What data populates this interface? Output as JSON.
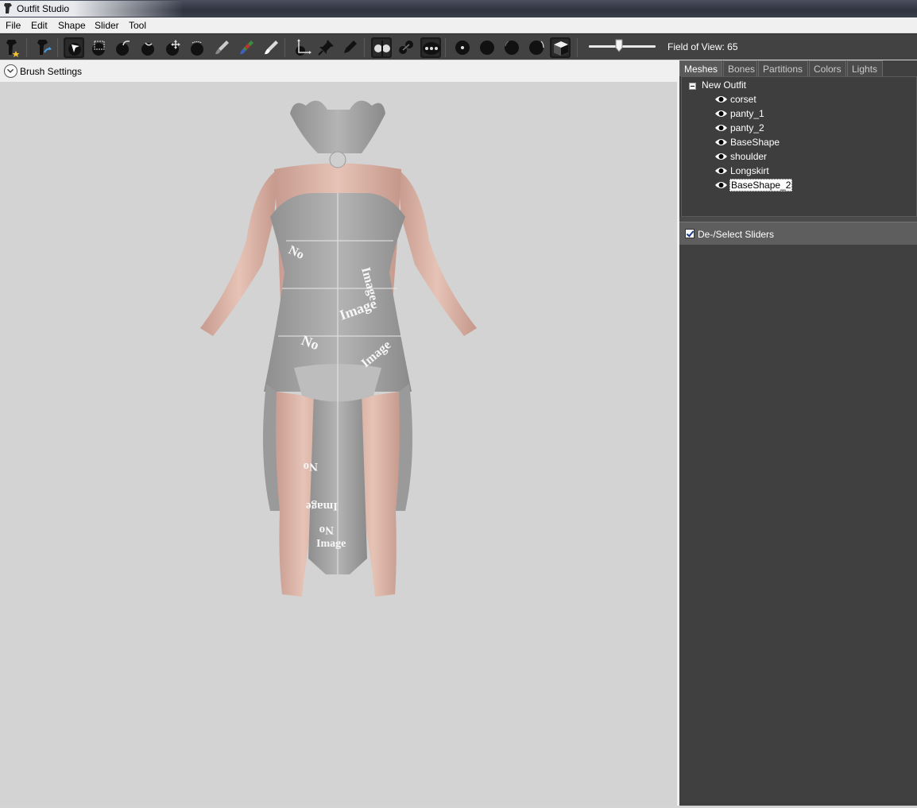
{
  "window": {
    "title": "Outfit Studio"
  },
  "menu": [
    "File",
    "Edit",
    "Shape",
    "Slider",
    "Tool"
  ],
  "toolbar": {
    "fov_label": "Field of View: 65",
    "fov_value": 65
  },
  "brush_settings": {
    "label": "Brush Settings"
  },
  "tabs": [
    "Meshes",
    "Bones",
    "Partitions",
    "Colors",
    "Lights"
  ],
  "active_tab": "Meshes",
  "tree": {
    "root": "New Outfit",
    "items": [
      "corset",
      "panty_1",
      "panty_2",
      "BaseShape",
      "shoulder",
      "Longskirt",
      "BaseShape_2"
    ],
    "selected": "BaseShape_2"
  },
  "sliders": {
    "toggle_label": "De-/Select Sliders",
    "checked": true
  },
  "colors": {
    "toolbar_bg": "#424242",
    "panel_bg": "#404040",
    "viewport_bg": "#d3d3d3"
  },
  "viewport": {
    "texture_text_1": "No",
    "texture_text_2": "Image"
  }
}
